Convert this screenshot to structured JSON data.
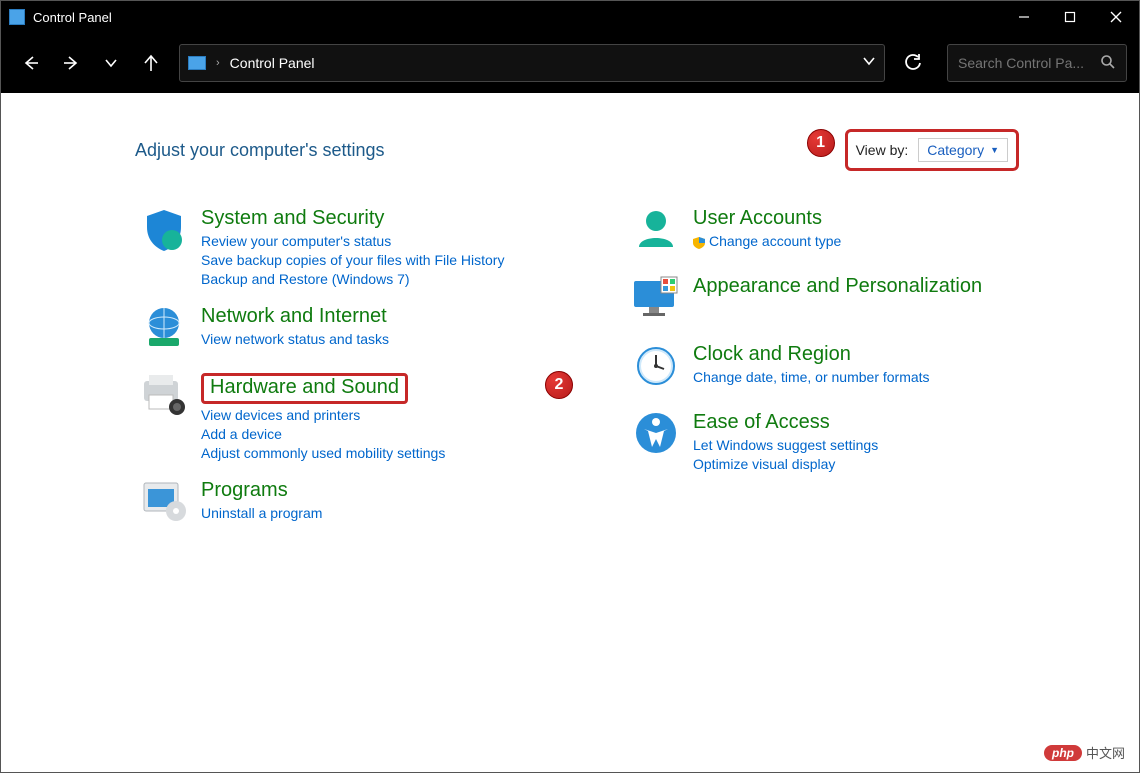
{
  "window": {
    "title": "Control Panel"
  },
  "address": {
    "crumb": "Control Panel"
  },
  "search": {
    "placeholder": "Search Control Pa..."
  },
  "heading": "Adjust your computer's settings",
  "viewby": {
    "label": "View by:",
    "value": "Category"
  },
  "annotations": {
    "one": "1",
    "two": "2"
  },
  "left": {
    "sys": {
      "title": "System and Security",
      "l1": "Review your computer's status",
      "l2": "Save backup copies of your files with File History",
      "l3": "Backup and Restore (Windows 7)"
    },
    "net": {
      "title": "Network and Internet",
      "l1": "View network status and tasks"
    },
    "hw": {
      "title": "Hardware and Sound",
      "l1": "View devices and printers",
      "l2": "Add a device",
      "l3": "Adjust commonly used mobility settings"
    },
    "prog": {
      "title": "Programs",
      "l1": "Uninstall a program"
    }
  },
  "right": {
    "user": {
      "title": "User Accounts",
      "l1": "Change account type"
    },
    "app": {
      "title": "Appearance and Personalization"
    },
    "clock": {
      "title": "Clock and Region",
      "l1": "Change date, time, or number formats"
    },
    "ease": {
      "title": "Ease of Access",
      "l1": "Let Windows suggest settings",
      "l2": "Optimize visual display"
    }
  },
  "watermark": {
    "pill": "php",
    "text": "中文网"
  }
}
